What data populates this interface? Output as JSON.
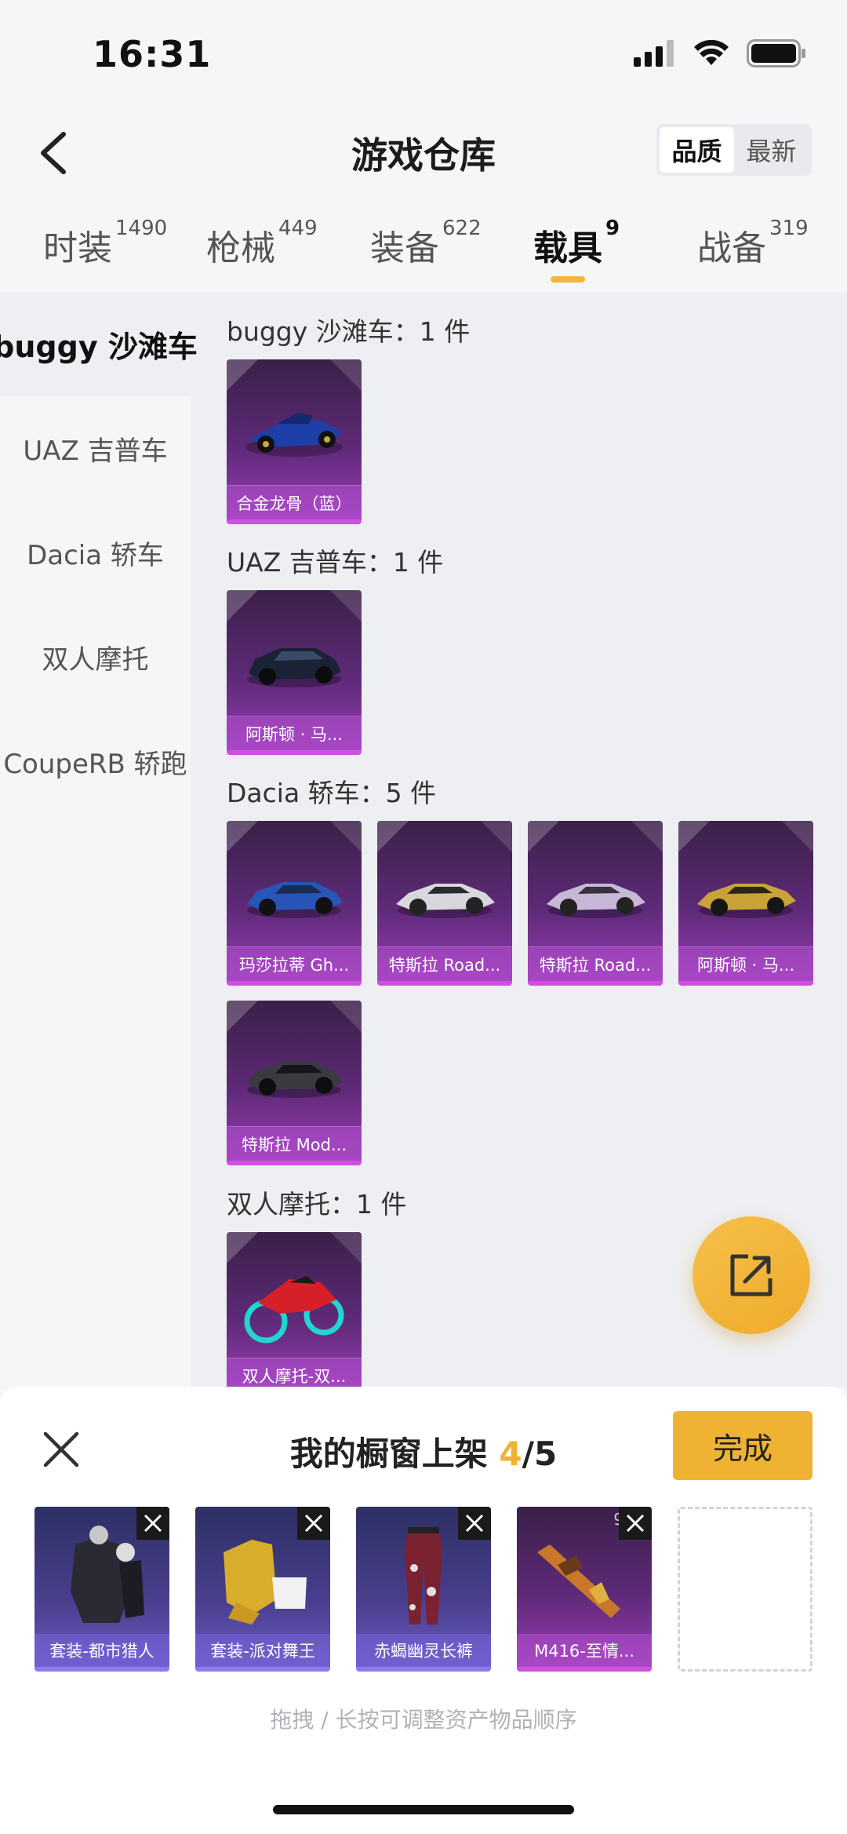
{
  "status": {
    "time": "16:31"
  },
  "header": {
    "title": "游戏仓库",
    "sort_quality": "品质",
    "sort_newest": "最新"
  },
  "tabs": [
    {
      "label": "时装",
      "count": "1490"
    },
    {
      "label": "枪械",
      "count": "449"
    },
    {
      "label": "装备",
      "count": "622"
    },
    {
      "label": "载具",
      "count": "9"
    },
    {
      "label": "战备",
      "count": "319"
    }
  ],
  "sidebar": [
    {
      "label": "buggy 沙滩车"
    },
    {
      "label": "UAZ 吉普车"
    },
    {
      "label": "Dacia 轿车"
    },
    {
      "label": "双人摩托"
    },
    {
      "label": "CoupeRB 轿跑"
    }
  ],
  "groups": [
    {
      "title": "buggy 沙滩车：1 件",
      "items": [
        "合金龙骨（蓝）"
      ]
    },
    {
      "title": "UAZ 吉普车：1 件",
      "items": [
        "阿斯顿 · 马..."
      ]
    },
    {
      "title": "Dacia 轿车：5 件",
      "items": [
        "玛莎拉蒂 Gh...",
        "特斯拉 Road...",
        "特斯拉 Road...",
        "阿斯顿 · 马...",
        "特斯拉 Mod..."
      ]
    },
    {
      "title": "双人摩托：1 件",
      "items": [
        "双人摩托-双..."
      ]
    }
  ],
  "sheet": {
    "title": "我的橱窗上架 ",
    "count": "4",
    "total": "/5",
    "done_label": "完成",
    "hint": "拖拽 / 长按可调整资产物品顺序",
    "items": [
      "套装-都市猎人",
      "套装-派对舞王",
      "赤蝎幽灵长裤",
      "M416-至情..."
    ],
    "badge": "9"
  },
  "colors": {
    "accent": "#f0b232",
    "card_purple": "#5e2a78",
    "card_blue": "#4a3f8f"
  }
}
